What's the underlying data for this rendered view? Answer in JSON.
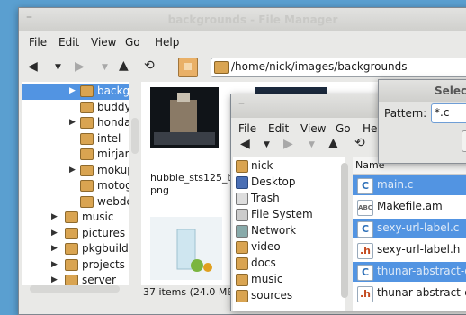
{
  "back_window": {
    "title": "backgrounds - File Manager",
    "menu": [
      "File",
      "Edit",
      "View",
      "Go",
      "Help"
    ],
    "address": "/home/nick/images/backgrounds",
    "tree": [
      {
        "label": "backgr",
        "expander": "▶",
        "selected": true
      },
      {
        "label": "buddy",
        "expander": ""
      },
      {
        "label": "honda",
        "expander": "▶"
      },
      {
        "label": "intel",
        "expander": ""
      },
      {
        "label": "mirjam",
        "expander": ""
      },
      {
        "label": "mokup",
        "expander": "▶"
      },
      {
        "label": "motog",
        "expander": ""
      },
      {
        "label": "webde",
        "expander": ""
      },
      {
        "label": "music",
        "expander": "▶"
      },
      {
        "label": "pictures",
        "expander": "▶"
      },
      {
        "label": "pkgbuilds",
        "expander": "▶"
      },
      {
        "label": "projects",
        "expander": "▶"
      },
      {
        "label": "server",
        "expander": "▶"
      }
    ],
    "thumb_caption_line1": "hubble_sts125_b",
    "thumb_caption_line2": "png",
    "status": "37 items (24.0 MB"
  },
  "front_window": {
    "menu": [
      "File",
      "Edit",
      "View",
      "Go",
      "He"
    ],
    "sidebar": [
      {
        "label": "nick",
        "icon": "folder"
      },
      {
        "label": "Desktop",
        "icon": "desk"
      },
      {
        "label": "Trash",
        "icon": "trash"
      },
      {
        "label": "File System",
        "icon": "fs"
      },
      {
        "label": "Network",
        "icon": "net"
      },
      {
        "label": "video",
        "icon": "folder"
      },
      {
        "label": "docs",
        "icon": "folder"
      },
      {
        "label": "music",
        "icon": "folder"
      },
      {
        "label": "sources",
        "icon": "folder"
      }
    ],
    "column_header": "Name",
    "files": [
      {
        "label": "main.c",
        "type": "c",
        "selected": true
      },
      {
        "label": "Makefile.am",
        "type": "abc",
        "selected": false
      },
      {
        "label": "sexy-url-label.c",
        "type": "c",
        "selected": true
      },
      {
        "label": "sexy-url-label.h",
        "type": "h",
        "selected": false
      },
      {
        "label": "thunar-abstract-di",
        "type": "c",
        "selected": true
      },
      {
        "label": "thunar-abstract-di",
        "type": "h",
        "selected": false
      }
    ]
  },
  "dialog": {
    "title": "Select",
    "pattern_label": "Pattern:",
    "pattern_value": "*.c"
  }
}
